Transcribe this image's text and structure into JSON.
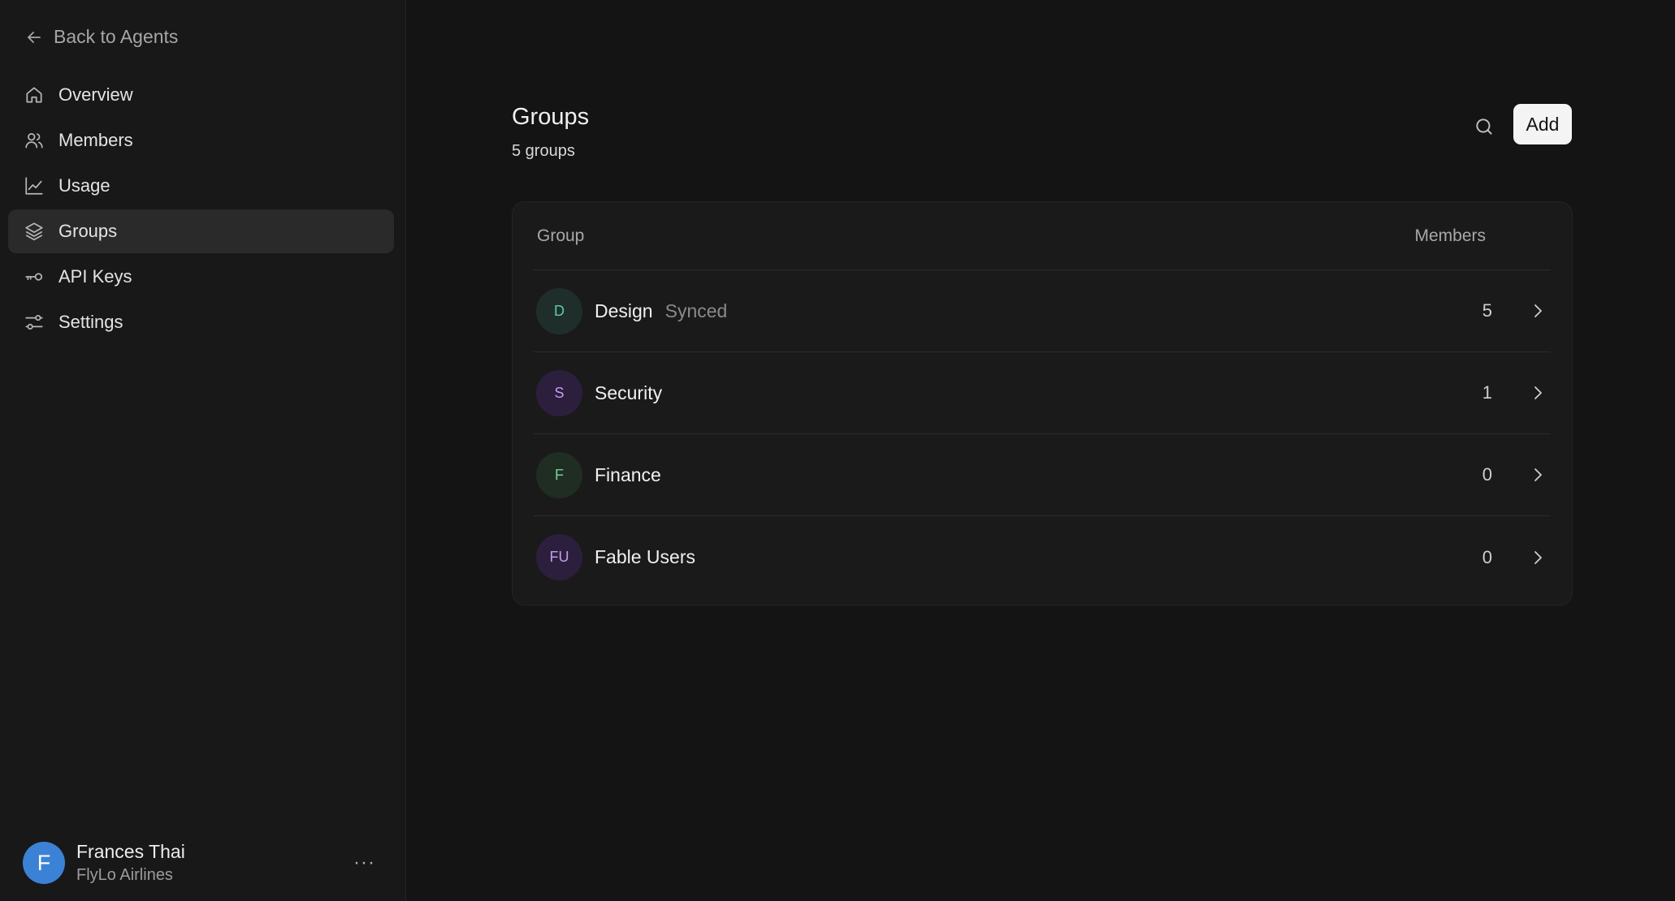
{
  "sidebar": {
    "back_label": "Back to Agents",
    "items": [
      {
        "label": "Overview",
        "icon": "home-icon"
      },
      {
        "label": "Members",
        "icon": "users-icon"
      },
      {
        "label": "Usage",
        "icon": "chart-line-icon"
      },
      {
        "label": "Groups",
        "icon": "layers-icon",
        "active": true
      },
      {
        "label": "API Keys",
        "icon": "key-icon"
      },
      {
        "label": "Settings",
        "icon": "sliders-icon"
      }
    ],
    "user": {
      "initial": "F",
      "name": "Frances Thai",
      "org": "FlyLo Airlines",
      "more": "···",
      "avatar_color": "#3b82d6"
    }
  },
  "main": {
    "title": "Groups",
    "subtitle": "5 groups",
    "add_label": "Add",
    "table": {
      "columns": [
        "Group",
        "Members"
      ],
      "rows": [
        {
          "initials": "D",
          "name": "Design",
          "tag": "Synced",
          "members": "5",
          "avatar_bg": "#1f2e2b",
          "avatar_fg": "#5fc8a8"
        },
        {
          "initials": "S",
          "name": "Security",
          "tag": "",
          "members": "1",
          "avatar_bg": "#2c1f3d",
          "avatar_fg": "#c49cf0"
        },
        {
          "initials": "F",
          "name": "Finance",
          "tag": "",
          "members": "0",
          "avatar_bg": "#1f2d22",
          "avatar_fg": "#78d090"
        },
        {
          "initials": "FU",
          "name": "Fable Users",
          "tag": "",
          "members": "0",
          "avatar_bg": "#2c1f3d",
          "avatar_fg": "#c49cf0"
        }
      ]
    }
  }
}
